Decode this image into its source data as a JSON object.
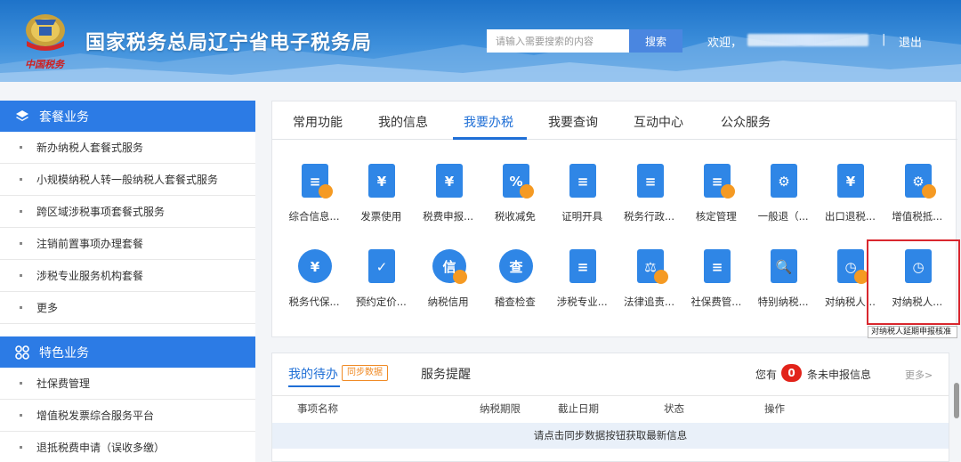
{
  "header": {
    "slogan": "中国税务",
    "site_title": "国家税务总局辽宁省电子税务局",
    "search_placeholder": "请输入需要搜索的内容",
    "search_button": "搜索",
    "welcome": "欢迎，",
    "separator": "|",
    "logout": "退出"
  },
  "sidebar": {
    "section1": {
      "title": "套餐业务",
      "icon": "layers-icon",
      "items": [
        "新办纳税人套餐式服务",
        "小规模纳税人转一般纳税人套餐式服务",
        "跨区域涉税事项套餐式服务",
        "注销前置事项办理套餐",
        "涉税专业服务机构套餐",
        "更多"
      ]
    },
    "section2": {
      "title": "特色业务",
      "icon": "grid-icon",
      "items": [
        "社保费管理",
        "增值税发票综合服务平台",
        "退抵税费申请（误收多缴）"
      ]
    }
  },
  "main": {
    "tabs": [
      "常用功能",
      "我的信息",
      "我要办税",
      "我要查询",
      "互动中心",
      "公众服务"
    ],
    "active_tab": "我要办税",
    "services": [
      "综合信息...",
      "发票使用",
      "税费申报...",
      "税收减免",
      "证明开具",
      "税务行政...",
      "核定管理",
      "一般退（...",
      "出口退税...",
      "增值税抵...",
      "税务代保...",
      "预约定价...",
      "纳税信用",
      "稽查检查",
      "涉税专业...",
      "法律追责...",
      "社保费管...",
      "特别纳税...",
      "对纳税人...",
      "对纳税人..."
    ],
    "tooltip": "对纳税人延期申报核准"
  },
  "pending": {
    "tab_todo": "我的待办",
    "sync_badge": "同步数据",
    "tab_reminder": "服务提醒",
    "you_have": "您有",
    "count": "0",
    "unfiled": "条未申报信息",
    "more": "更多>",
    "columns": [
      "事项名称",
      "纳税期限",
      "截止日期",
      "状态",
      "操作"
    ],
    "empty_message": "请点击同步数据按钮获取最新信息"
  },
  "colors": {
    "primary": "#2c7be5",
    "tab_active": "#1f6fd6",
    "icon_blue": "#2f86e6",
    "icon_orange": "#f59a23",
    "badge_red": "#e2231a",
    "highlight_red": "#d9272e"
  }
}
